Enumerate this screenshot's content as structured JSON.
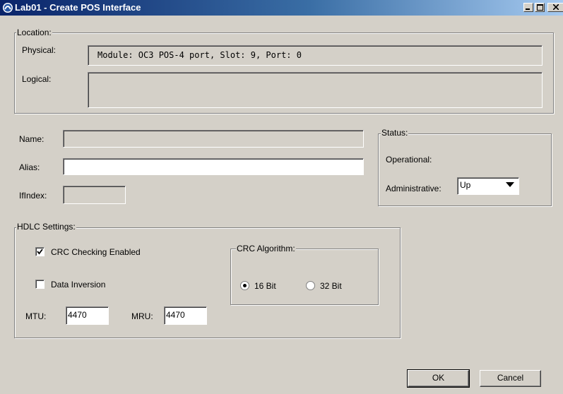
{
  "window": {
    "title": "Lab01 - Create POS Interface",
    "controls": {
      "minimize": "_",
      "maximize": "□",
      "close": "×"
    }
  },
  "location": {
    "legend": "Location:",
    "physical_label": "Physical:",
    "physical_value": "Module: OC3 POS-4 port, Slot: 9, Port: 0",
    "logical_label": "Logical:",
    "logical_value": ""
  },
  "identity": {
    "name_label": "Name:",
    "name_value": "",
    "alias_label": "Alias:",
    "alias_value": "",
    "ifindex_label": "IfIndex:",
    "ifindex_value": ""
  },
  "status": {
    "legend": "Status:",
    "operational_label": "Operational:",
    "operational_value": "",
    "administrative_label": "Administrative:",
    "administrative_value": "Up"
  },
  "hdlc": {
    "legend": "HDLC Settings:",
    "crc_checking_label": "CRC Checking Enabled",
    "crc_checking_checked": true,
    "data_inversion_label": "Data Inversion",
    "data_inversion_checked": false,
    "mtu_label": "MTU:",
    "mtu_value": "4470",
    "mru_label": "MRU:",
    "mru_value": "4470",
    "crc_algorithm": {
      "legend": "CRC Algorithm:",
      "option_16": "16 Bit",
      "option_32": "32 Bit",
      "selected": "16 Bit"
    }
  },
  "buttons": {
    "ok": "OK",
    "cancel": "Cancel"
  },
  "icons": {
    "app": "app-window-icon",
    "dropdown": "chevron-down-icon",
    "check": "checkmark-icon"
  },
  "colors": {
    "face": "#d4d0c8",
    "title_start": "#0a246a",
    "title_end": "#a6caf0"
  }
}
